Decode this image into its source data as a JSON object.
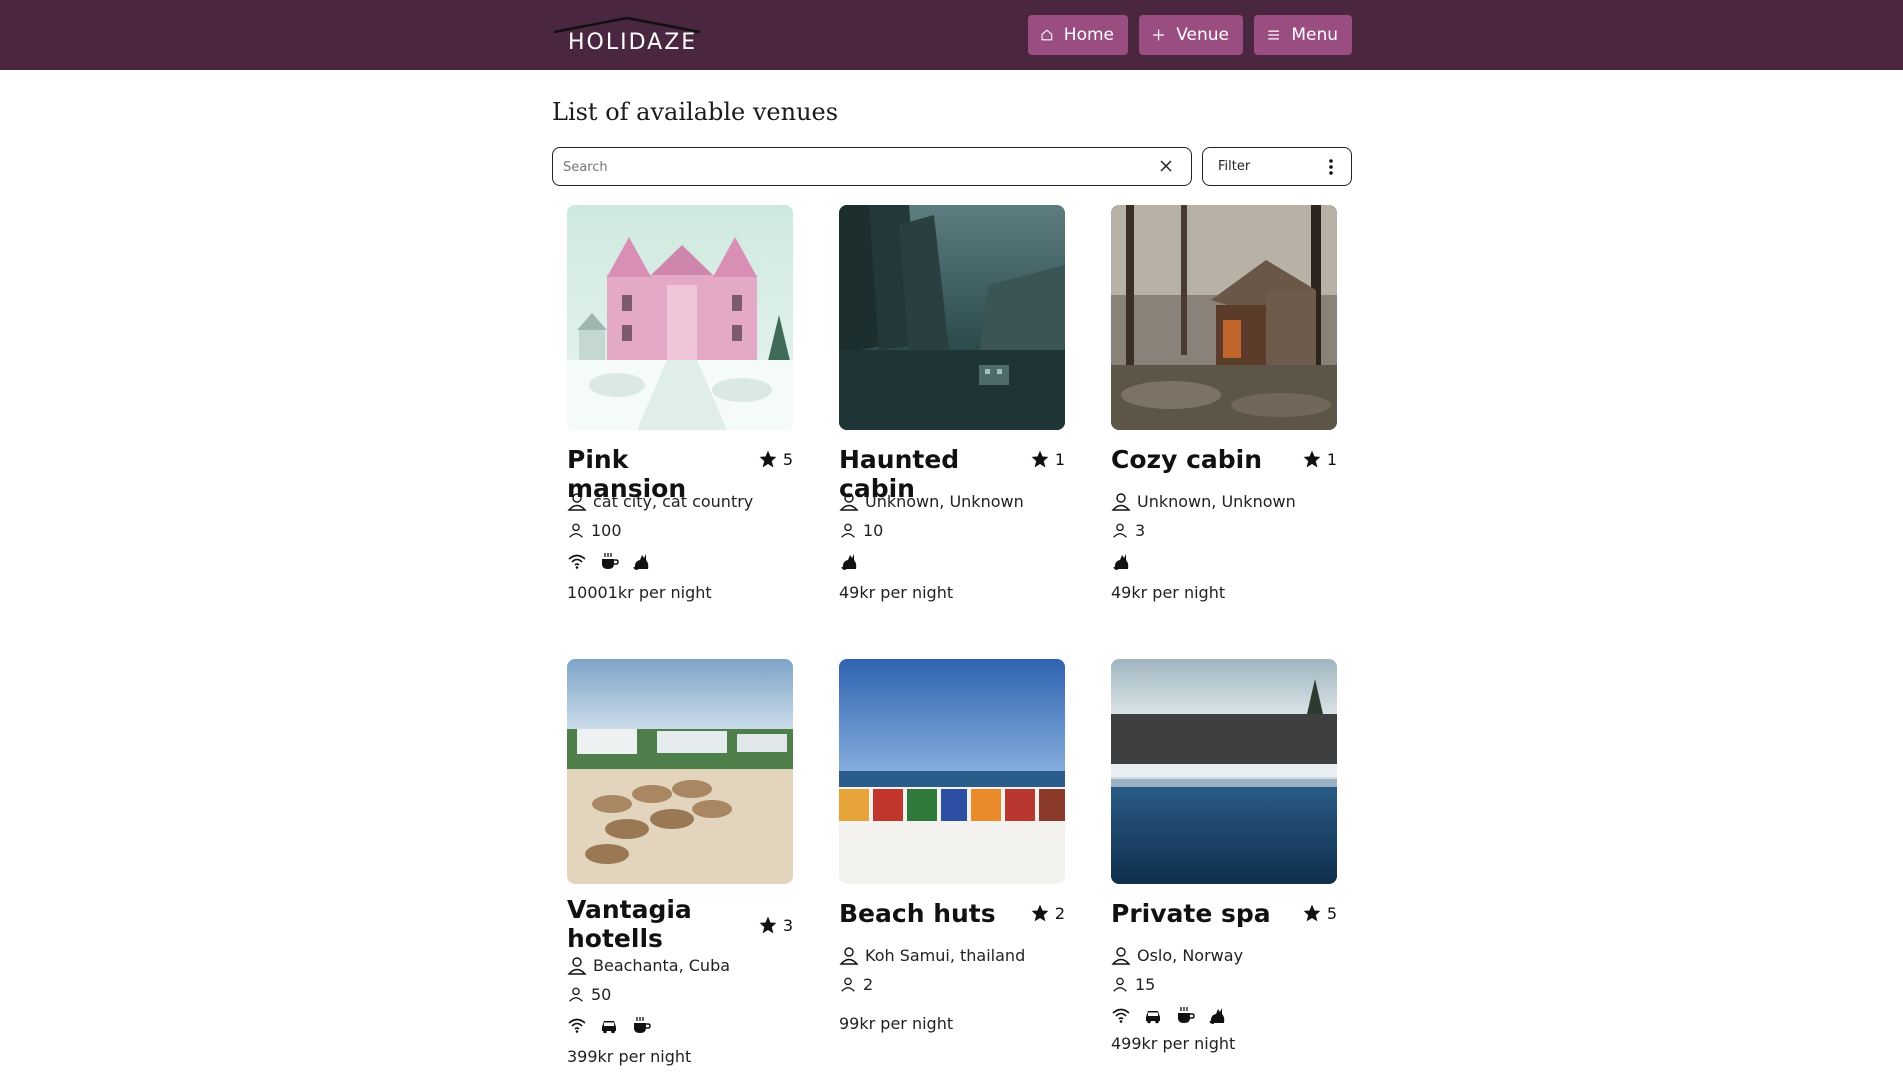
{
  "header": {
    "logo_text": "HOLIDAZE",
    "nav": {
      "home_label": "Home",
      "venue_label": "Venue",
      "menu_label": "Menu"
    },
    "colors": {
      "background": "#4a2640",
      "button": "#9a4d80"
    }
  },
  "main": {
    "title": "List of available venues",
    "search": {
      "placeholder": "Search",
      "value": ""
    },
    "filter": {
      "label": "Filter"
    }
  },
  "venues": [
    {
      "name": "Pink mansion",
      "rating": "5",
      "location": "cat city, cat country",
      "guests": "100",
      "amenities": [
        "wifi-icon",
        "breakfast-icon",
        "pets-icon"
      ],
      "price": "10001kr per night"
    },
    {
      "name": "Haunted cabin",
      "rating": "1",
      "location": "Unknown, Unknown",
      "guests": "10",
      "amenities": [
        "pets-icon"
      ],
      "price": "49kr per night"
    },
    {
      "name": "Cozy cabin",
      "rating": "1",
      "location": "Unknown, Unknown",
      "guests": "3",
      "amenities": [
        "pets-icon"
      ],
      "price": "49kr per night"
    },
    {
      "name": "Vantagia hotells",
      "rating": "3",
      "location": "Beachanta, Cuba",
      "guests": "50",
      "amenities": [
        "wifi-icon",
        "parking-icon",
        "breakfast-icon"
      ],
      "price": "399kr per night"
    },
    {
      "name": "Beach huts",
      "rating": "2",
      "location": "Koh Samui, thailand",
      "guests": "2",
      "amenities": [],
      "price": "99kr per night"
    },
    {
      "name": "Private spa",
      "rating": "5",
      "location": "Oslo, Norway",
      "guests": "15",
      "amenities": [
        "wifi-icon",
        "parking-icon",
        "breakfast-icon",
        "pets-icon"
      ],
      "price": "499kr per night"
    }
  ]
}
